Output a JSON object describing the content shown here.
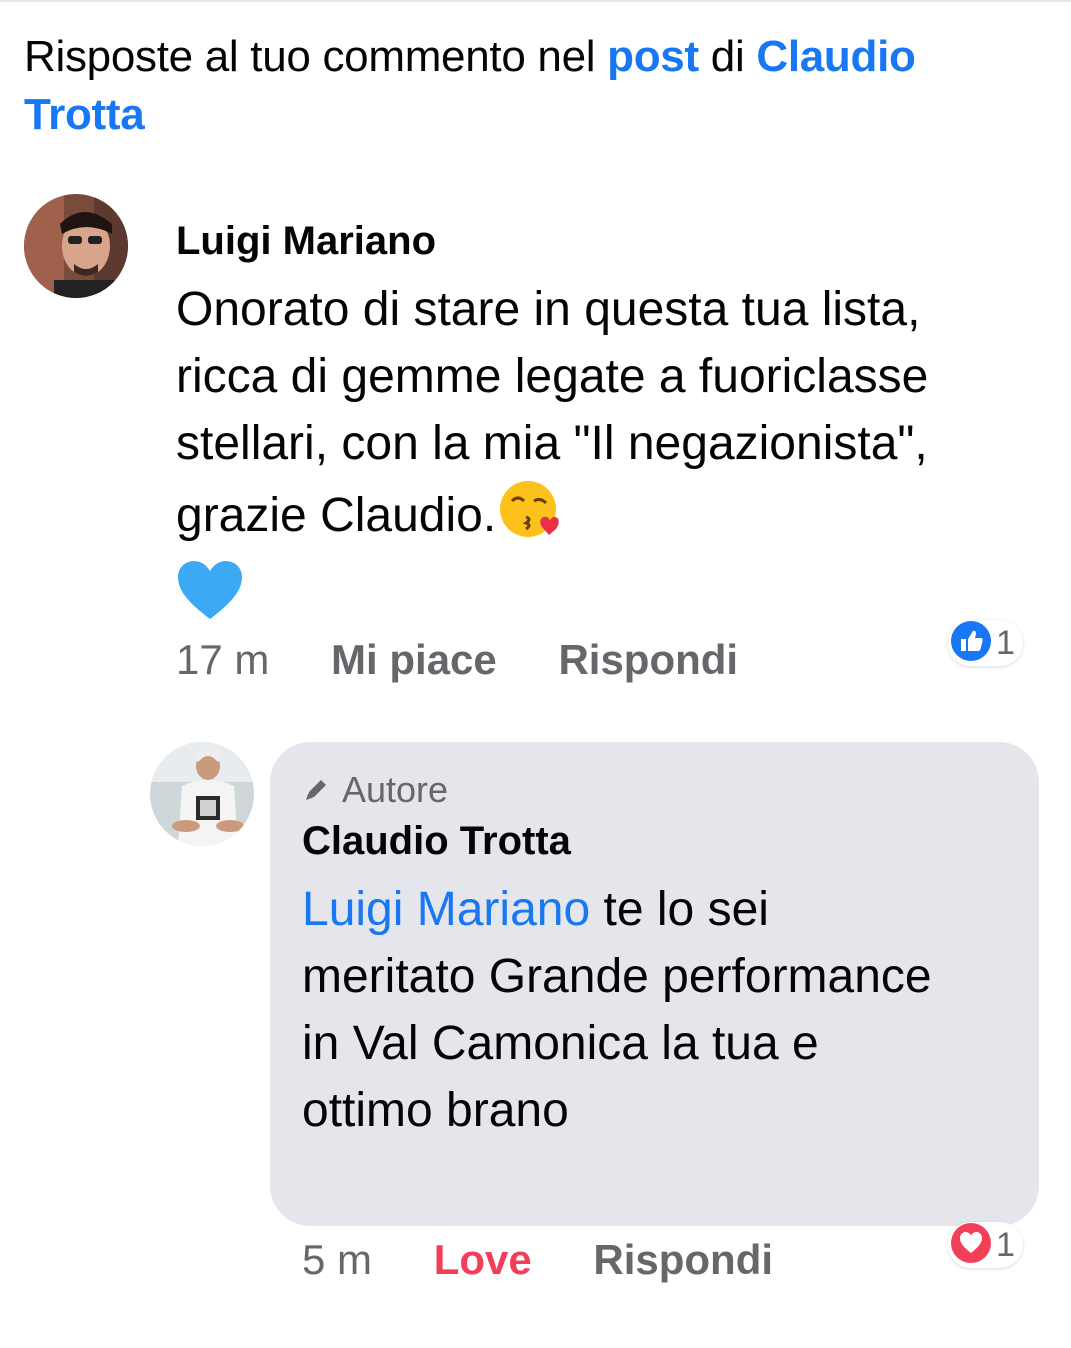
{
  "header": {
    "prefix": "Risposte al tuo commento nel ",
    "post_link": "post",
    "middle": " di ",
    "author_link": "Claudio Trotta"
  },
  "comment": {
    "author": "Luigi Mariano",
    "text": "Onorato di stare in questa tua lista, ricca di gemme legate a fuoriclasse stellari, con la mia \"Il negazionista\", grazie Claudio.",
    "emojis": [
      "face-blowing-kiss-icon",
      "blue-heart-icon"
    ],
    "time": "17 m",
    "like_label": "Mi piace",
    "reply_label": "Rispondi",
    "reaction": {
      "type": "like-icon",
      "count": "1"
    }
  },
  "reply": {
    "badge": "Autore",
    "author": "Claudio Trotta",
    "mention": "Luigi Mariano",
    "text": " te lo sei meritato Grande performance in Val Camonica la tua e ottimo brano",
    "time": "5 m",
    "reaction_label": "Love",
    "reply_label": "Rispondi",
    "reaction": {
      "type": "love-icon",
      "count": "1"
    }
  },
  "colors": {
    "link": "#1877f2",
    "love": "#f33e58",
    "bubble": "#e4e6eb",
    "secondary_text": "#65676b"
  }
}
